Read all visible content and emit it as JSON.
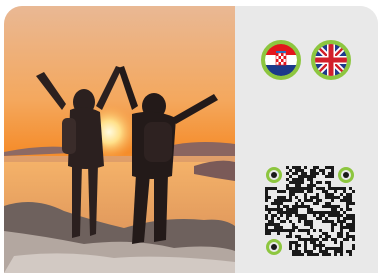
{
  "photo": {
    "icon": "hikers-sunset-photo",
    "colors": {
      "sky_top": "#f7b86a",
      "sky_low": "#f08a2a",
      "sun": "#fff6c8",
      "sea": "#f3a35a",
      "rock": "#7a6a62"
    }
  },
  "languages": [
    {
      "code": "hr",
      "icon": "croatia-flag-icon",
      "accent": "#8dc63f"
    },
    {
      "code": "en",
      "icon": "uk-flag-icon",
      "accent": "#8dc63f"
    }
  ],
  "qr": {
    "icon": "qr-code-icon",
    "accent": "#8dc63f"
  }
}
